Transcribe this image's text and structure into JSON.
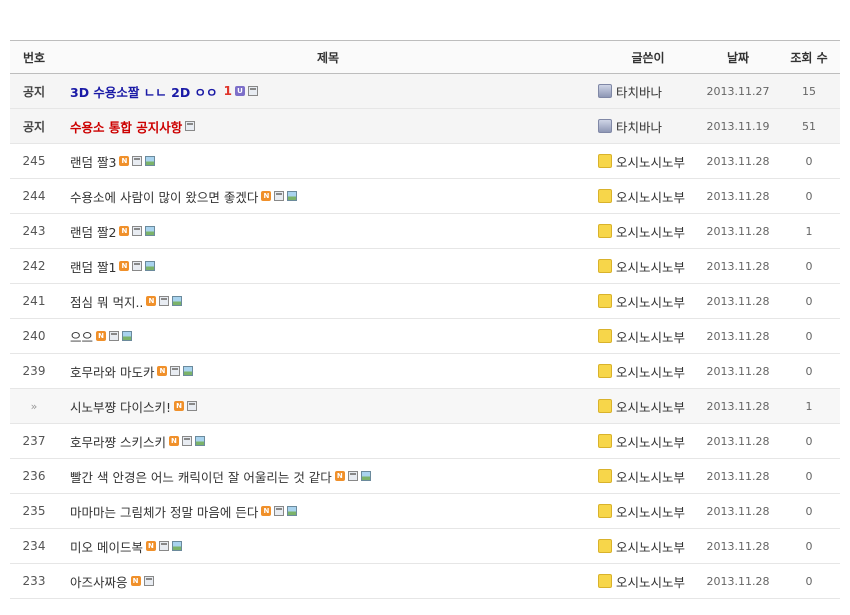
{
  "header": {
    "no": "번호",
    "title": "제목",
    "author": "글쓴이",
    "date": "날짜",
    "views": "조회 수"
  },
  "notices": [
    {
      "no": "공지",
      "title": "3D 수용소짤 ㄴㄴ 2D ㅇㅇ",
      "comments": "1",
      "author": "타치바나",
      "date": "2013.11.27",
      "views": "15"
    },
    {
      "no": "공지",
      "title": "수용소 통합 공지사항",
      "author": "타치바나",
      "date": "2013.11.19",
      "views": "51"
    }
  ],
  "posts": [
    {
      "no": "245",
      "title": "랜덤 짤3",
      "author": "오시노시노부",
      "date": "2013.11.28",
      "views": "0"
    },
    {
      "no": "244",
      "title": "수용소에 사람이 많이 왔으면 좋겠다",
      "author": "오시노시노부",
      "date": "2013.11.28",
      "views": "0"
    },
    {
      "no": "243",
      "title": "랜덤 짤2",
      "author": "오시노시노부",
      "date": "2013.11.28",
      "views": "1"
    },
    {
      "no": "242",
      "title": "랜덤 짤1",
      "author": "오시노시노부",
      "date": "2013.11.28",
      "views": "0"
    },
    {
      "no": "241",
      "title": "점심 뭐 먹지..",
      "author": "오시노시노부",
      "date": "2013.11.28",
      "views": "0"
    },
    {
      "no": "240",
      "title": "으으",
      "author": "오시노시노부",
      "date": "2013.11.28",
      "views": "0"
    },
    {
      "no": "239",
      "title": "호무라와 마도카",
      "author": "오시노시노부",
      "date": "2013.11.28",
      "views": "0"
    },
    {
      "no": "»",
      "title": "시노부쨩 다이스키!",
      "author": "오시노시노부",
      "date": "2013.11.28",
      "views": "1"
    },
    {
      "no": "237",
      "title": "호무라쨩 스키스키",
      "author": "오시노시노부",
      "date": "2013.11.28",
      "views": "0"
    },
    {
      "no": "236",
      "title": "빨간 색 안경은 어느 캐릭이던 잘 어울리는 것 같다",
      "author": "오시노시노부",
      "date": "2013.11.28",
      "views": "0"
    },
    {
      "no": "235",
      "title": "마마마는 그림체가 정말 마음에 든다",
      "author": "오시노시노부",
      "date": "2013.11.28",
      "views": "0"
    },
    {
      "no": "234",
      "title": "미오 메이드복",
      "author": "오시노시노부",
      "date": "2013.11.28",
      "views": "0"
    },
    {
      "no": "233",
      "title": "아즈사짜응",
      "author": "오시노시노부",
      "date": "2013.11.28",
      "views": "0"
    }
  ],
  "icons": {
    "new": "N",
    "unread": "U"
  },
  "colors": {
    "notice_blue": "#1a1aa6",
    "notice_red": "#cc0000",
    "new_badge": "#f0902a"
  }
}
